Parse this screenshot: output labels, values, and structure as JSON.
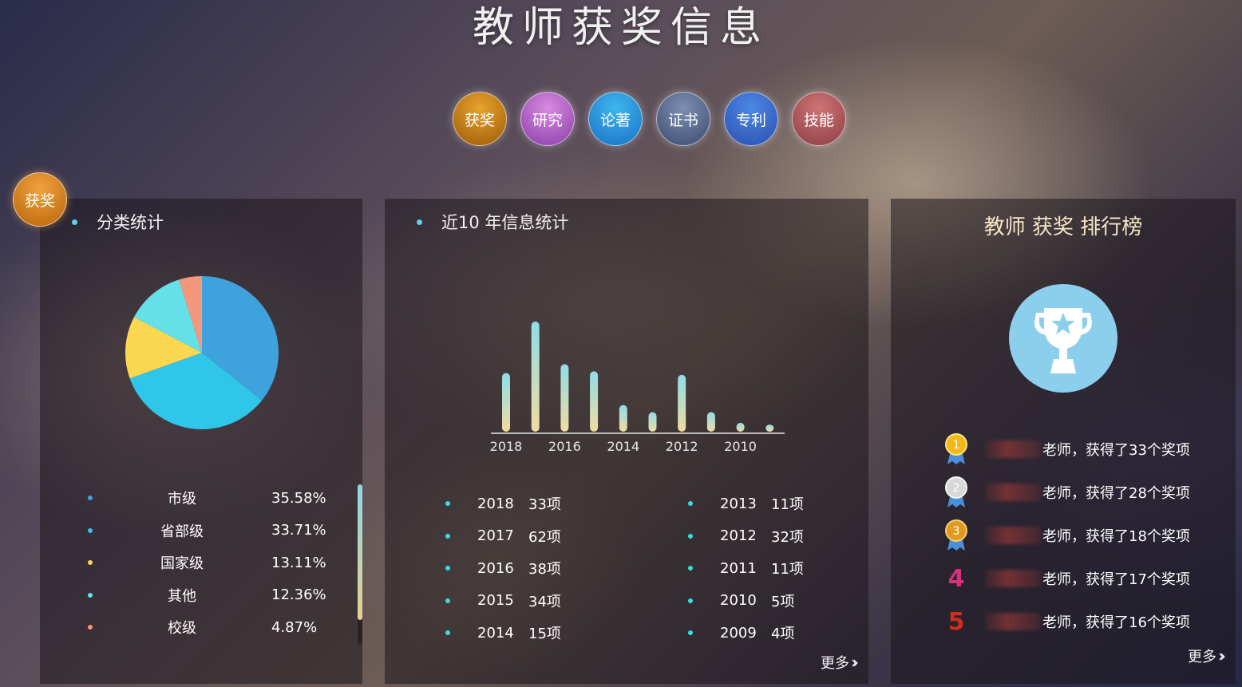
{
  "page": {
    "title": "教师获奖信息"
  },
  "category_nav": [
    {
      "label": "获奖"
    },
    {
      "label": "研究"
    },
    {
      "label": "论著"
    },
    {
      "label": "证书"
    },
    {
      "label": "专利"
    },
    {
      "label": "技能"
    }
  ],
  "section_badge": "获奖",
  "classification": {
    "title": "分类统计",
    "items": [
      {
        "name": "市级",
        "percent": "35.58%",
        "color": "#3ea3dc",
        "value": 35.58
      },
      {
        "name": "省部级",
        "percent": "33.71%",
        "color": "#2fc6ea",
        "value": 33.71
      },
      {
        "name": "国家级",
        "percent": "13.11%",
        "color": "#fcd752",
        "value": 13.11
      },
      {
        "name": "其他",
        "percent": "12.36%",
        "color": "#66e0e8",
        "value": 12.36
      },
      {
        "name": "校级",
        "percent": "4.87%",
        "color": "#f4977c",
        "value": 4.87
      }
    ]
  },
  "yearly": {
    "title": "近10 年信息统计",
    "more_label": "更多",
    "left": [
      {
        "year": "2018",
        "count": "33项"
      },
      {
        "year": "2017",
        "count": "62项"
      },
      {
        "year": "2016",
        "count": "38项"
      },
      {
        "year": "2015",
        "count": "34项"
      },
      {
        "year": "2014",
        "count": "15项"
      }
    ],
    "right": [
      {
        "year": "2013",
        "count": "11项"
      },
      {
        "year": "2012",
        "count": "32项"
      },
      {
        "year": "2011",
        "count": "11项"
      },
      {
        "year": "2010",
        "count": "5项"
      },
      {
        "year": "2009",
        "count": "4项"
      }
    ]
  },
  "chart_data": {
    "type": "bar",
    "categories": [
      "2018",
      "2017",
      "2016",
      "2015",
      "2014",
      "2013",
      "2012",
      "2011",
      "2010",
      "2009"
    ],
    "values": [
      33,
      62,
      38,
      34,
      15,
      11,
      32,
      11,
      5,
      4
    ],
    "tick_labels": [
      "2018",
      "2016",
      "2014",
      "2012",
      "2010"
    ],
    "title": "",
    "xlabel": "",
    "ylabel": "",
    "grid": false
  },
  "ranking": {
    "title": "教师 获奖 排行榜",
    "more_label": "更多",
    "items": [
      {
        "rank": "1",
        "text": "老师，获得了33个奖项"
      },
      {
        "rank": "2",
        "text": "老师，获得了28个奖项"
      },
      {
        "rank": "3",
        "text": "老师，获得了18个奖项"
      },
      {
        "rank": "4",
        "text": "老师，获得了17个奖项"
      },
      {
        "rank": "5",
        "text": "老师，获得了16个奖项"
      }
    ]
  },
  "colors": {
    "rank4": "#d6307a",
    "rank5": "#d42a1c",
    "gold": "#f2b81a",
    "silver": "#d8d8d8",
    "bronze": "#e09a20"
  }
}
